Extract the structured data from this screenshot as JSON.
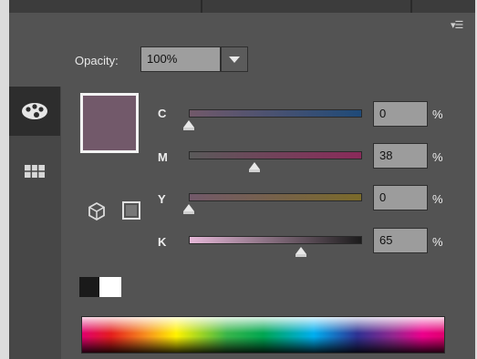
{
  "opacity": {
    "label": "Opacity:",
    "value": "100%"
  },
  "panel_menu_icon": "panel-menu-icon",
  "sidebar": {
    "items": [
      {
        "icon": "palette-icon",
        "active": true
      },
      {
        "icon": "swatches-grid-icon",
        "active": false
      }
    ]
  },
  "current_color": "#72596a",
  "sliders": [
    {
      "label": "C",
      "value": "0",
      "unit": "%",
      "level": 0.0
    },
    {
      "label": "M",
      "value": "38",
      "unit": "%",
      "level": 0.38
    },
    {
      "label": "Y",
      "value": "0",
      "unit": "%",
      "level": 0.0
    },
    {
      "label": "K",
      "value": "65",
      "unit": "%",
      "level": 0.65
    }
  ],
  "colors": {
    "panel_bg": "#535353",
    "sidebar_bg": "#474747",
    "field_bg": "#9c9c9c"
  }
}
